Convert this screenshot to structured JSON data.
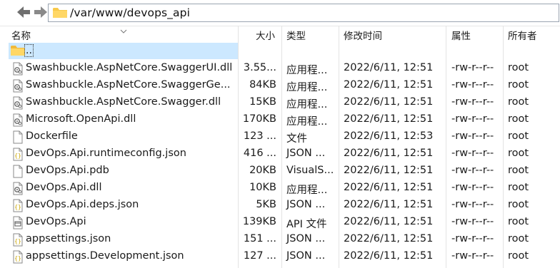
{
  "address": {
    "path": "/var/www/devops_api"
  },
  "columns": {
    "name": "名称",
    "size": "大小",
    "type": "类型",
    "modified": "修改时间",
    "attributes": "属性",
    "owner": "所有者"
  },
  "parent": {
    "label": ".."
  },
  "files": [
    {
      "icon": "dll-icon",
      "name": "Swashbuckle.AspNetCore.SwaggerUI.dll",
      "size": "3.55...",
      "type": "应用程...",
      "modified": "2022/6/11, 12:51",
      "attributes": "-rw-r--r--",
      "owner": "root"
    },
    {
      "icon": "dll-icon",
      "name": "Swashbuckle.AspNetCore.SwaggerGe...",
      "size": "84KB",
      "type": "应用程...",
      "modified": "2022/6/11, 12:51",
      "attributes": "-rw-r--r--",
      "owner": "root"
    },
    {
      "icon": "dll-icon",
      "name": "Swashbuckle.AspNetCore.Swagger.dll",
      "size": "15KB",
      "type": "应用程...",
      "modified": "2022/6/11, 12:51",
      "attributes": "-rw-r--r--",
      "owner": "root"
    },
    {
      "icon": "dll-icon",
      "name": "Microsoft.OpenApi.dll",
      "size": "170KB",
      "type": "应用程...",
      "modified": "2022/6/11, 12:51",
      "attributes": "-rw-r--r--",
      "owner": "root"
    },
    {
      "icon": "file-icon",
      "name": "Dockerfile",
      "size": "123 ...",
      "type": "文件",
      "modified": "2022/6/11, 12:53",
      "attributes": "-rw-r--r--",
      "owner": "root"
    },
    {
      "icon": "json-icon",
      "name": "DevOps.Api.runtimeconfig.json",
      "size": "416 ...",
      "type": "JSON ...",
      "modified": "2022/6/11, 12:51",
      "attributes": "-rw-r--r--",
      "owner": "root"
    },
    {
      "icon": "file-icon",
      "name": "DevOps.Api.pdb",
      "size": "20KB",
      "type": "VisualS...",
      "modified": "2022/6/11, 12:51",
      "attributes": "-rw-r--r--",
      "owner": "root"
    },
    {
      "icon": "dll-icon",
      "name": "DevOps.Api.dll",
      "size": "10KB",
      "type": "应用程...",
      "modified": "2022/6/11, 12:51",
      "attributes": "-rw-r--r--",
      "owner": "root"
    },
    {
      "icon": "json-icon",
      "name": "DevOps.Api.deps.json",
      "size": "5KB",
      "type": "JSON ...",
      "modified": "2022/6/11, 12:51",
      "attributes": "-rw-r--r--",
      "owner": "root"
    },
    {
      "icon": "exe-icon",
      "name": "DevOps.Api",
      "size": "139KB",
      "type": "API 文件",
      "modified": "2022/6/11, 12:51",
      "attributes": "-rw-r--r--",
      "owner": "root"
    },
    {
      "icon": "json-icon",
      "name": "appsettings.json",
      "size": "151 ...",
      "type": "JSON ...",
      "modified": "2022/6/11, 12:51",
      "attributes": "-rw-r--r--",
      "owner": "root"
    },
    {
      "icon": "json-icon",
      "name": "appsettings.Development.json",
      "size": "127 ...",
      "type": "JSON ...",
      "modified": "2022/6/11, 12:51",
      "attributes": "-rw-r--r--",
      "owner": "root"
    }
  ],
  "colors": {
    "selection": "#cce8ff",
    "folder": "#f8c94a",
    "nav_arrow": "#7a7a7a"
  }
}
